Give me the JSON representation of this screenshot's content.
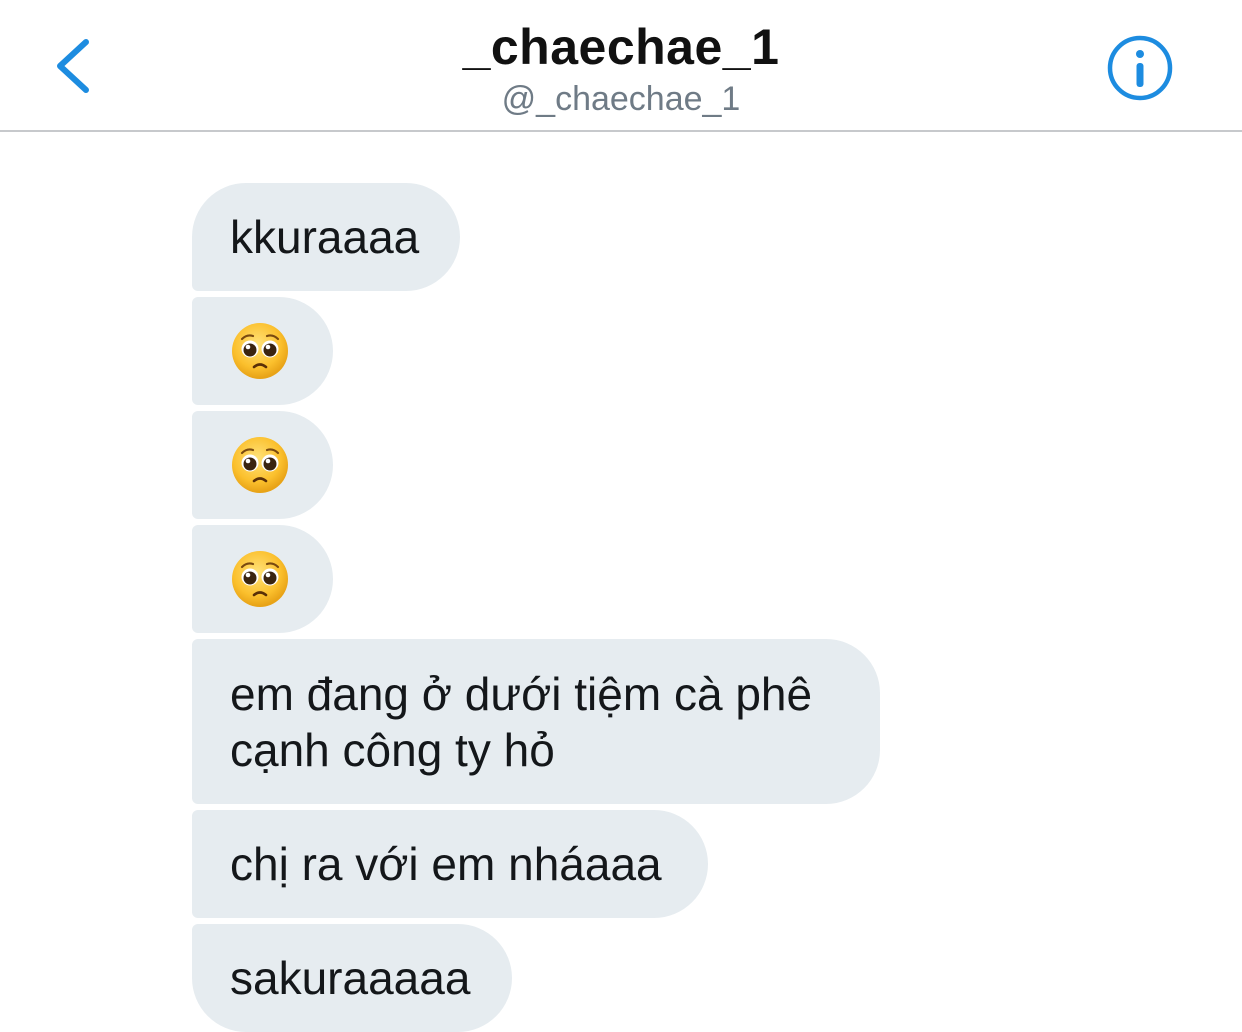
{
  "header": {
    "title": "_chaechae_1",
    "handle": "@_chaechae_1",
    "back_icon": "chevron-left-icon",
    "info_icon": "info-circle-icon",
    "accent_color": "#1d8ce0"
  },
  "messages": [
    {
      "type": "text",
      "text": "kkuraaaa"
    },
    {
      "type": "emoji",
      "emoji": "pleading-face-emoji"
    },
    {
      "type": "emoji",
      "emoji": "pleading-face-emoji"
    },
    {
      "type": "emoji",
      "emoji": "pleading-face-emoji"
    },
    {
      "type": "text",
      "line1": "em đang ở dưới tiệm cà phê",
      "line2": "cạnh công ty hỏ"
    },
    {
      "type": "text",
      "text": "chị ra với em nháaaa"
    },
    {
      "type": "text",
      "text": "sakuraaaaa"
    }
  ],
  "colors": {
    "bubble_bg": "#e6ecf0",
    "text": "#14171a",
    "handle": "#6f7b86",
    "divider": "#c7c9cc"
  }
}
